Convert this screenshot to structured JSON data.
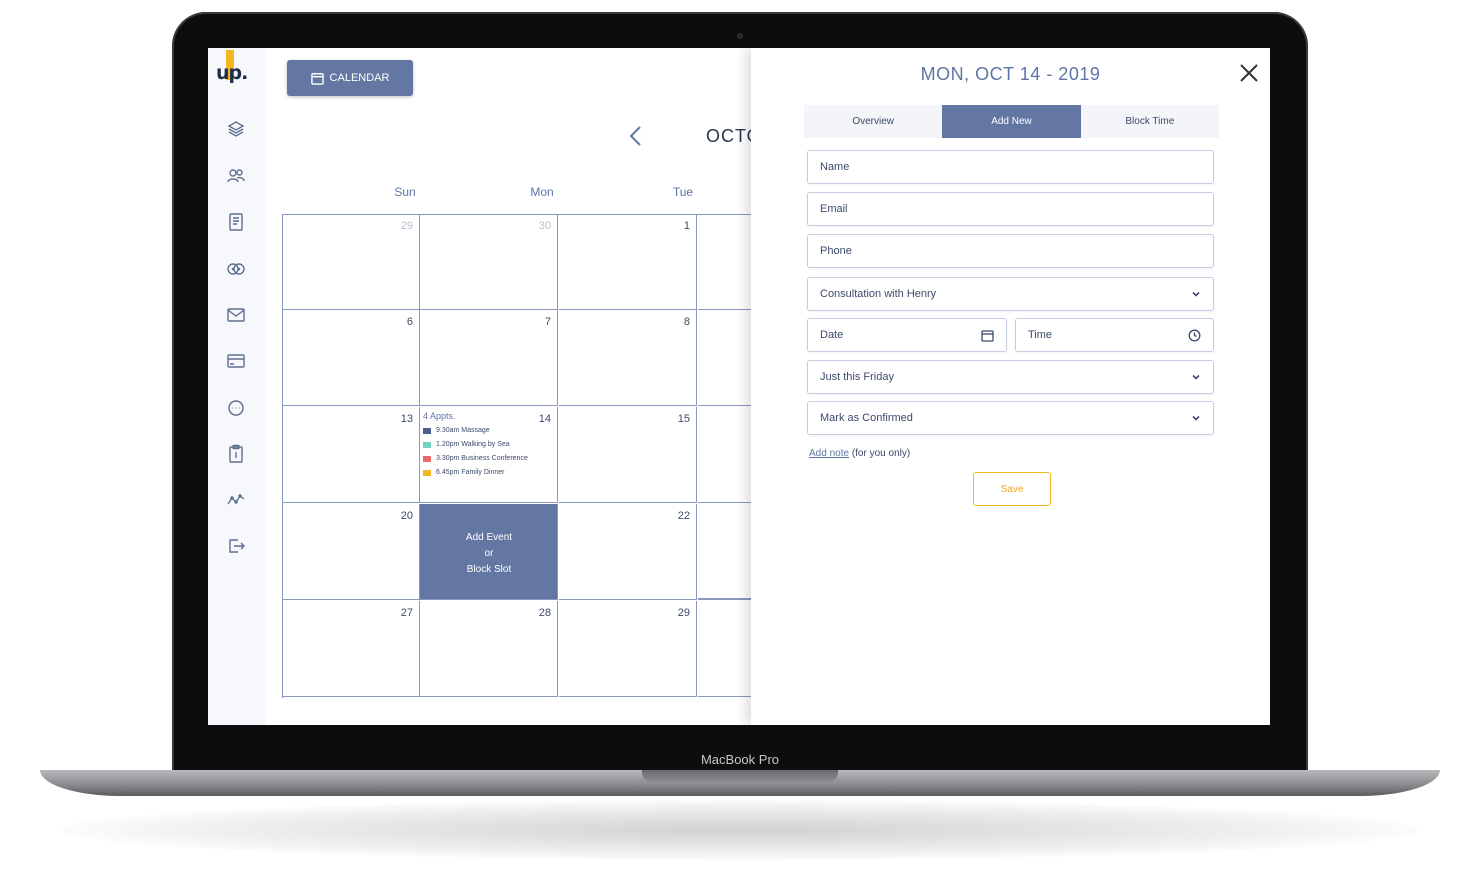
{
  "device": {
    "label": "MacBook Pro"
  },
  "sidebar": {
    "logo": "up.",
    "icons": [
      "layers-icon",
      "users-icon",
      "document-icon",
      "chat-bubbles-icon",
      "mail-icon",
      "card-icon",
      "message-icon",
      "clipboard-icon",
      "analytics-icon",
      "logout-icon"
    ]
  },
  "header": {
    "calendar_button": "CALENDAR",
    "month_title": "OCTO"
  },
  "calendar": {
    "weekdays": [
      "Sun",
      "Mon",
      "Tue"
    ],
    "weeks": [
      [
        "29",
        "30",
        "1"
      ],
      [
        "6",
        "7",
        "8"
      ],
      [
        "13",
        "14",
        "15"
      ],
      [
        "20",
        "",
        "22"
      ],
      [
        "27",
        "28",
        "29"
      ]
    ],
    "appointments": {
      "title": "4 Appts.",
      "items": [
        {
          "label": "9.30am Massage",
          "color": "#4d5f8a"
        },
        {
          "label": "1.20pm Walking by Sea",
          "color": "#6fd3c3"
        },
        {
          "label": "3.30pm Business Conference",
          "color": "#ea6a6a"
        },
        {
          "label": "6.45pm Family Dinner",
          "color": "#f5b720"
        }
      ]
    },
    "highlight_cell": {
      "line1": "Add Event",
      "line2": "or",
      "line3": "Block Slot"
    }
  },
  "panel": {
    "title": "MON, OCT 14 - 2019",
    "tabs": [
      "Overview",
      "Add New",
      "Block Time"
    ],
    "active_tab": "Add New",
    "fields": {
      "name": "Name",
      "email": "Email",
      "phone": "Phone",
      "service": "Consultation with Henry",
      "date": "Date",
      "time": "Time",
      "repeat": "Just this Friday",
      "status": "Mark as Confirmed"
    },
    "note_link": "Add note",
    "note_suffix": " (for you only)",
    "save": "Save"
  },
  "colors": {
    "accent": "#6377a2",
    "save": "#f5b720"
  }
}
